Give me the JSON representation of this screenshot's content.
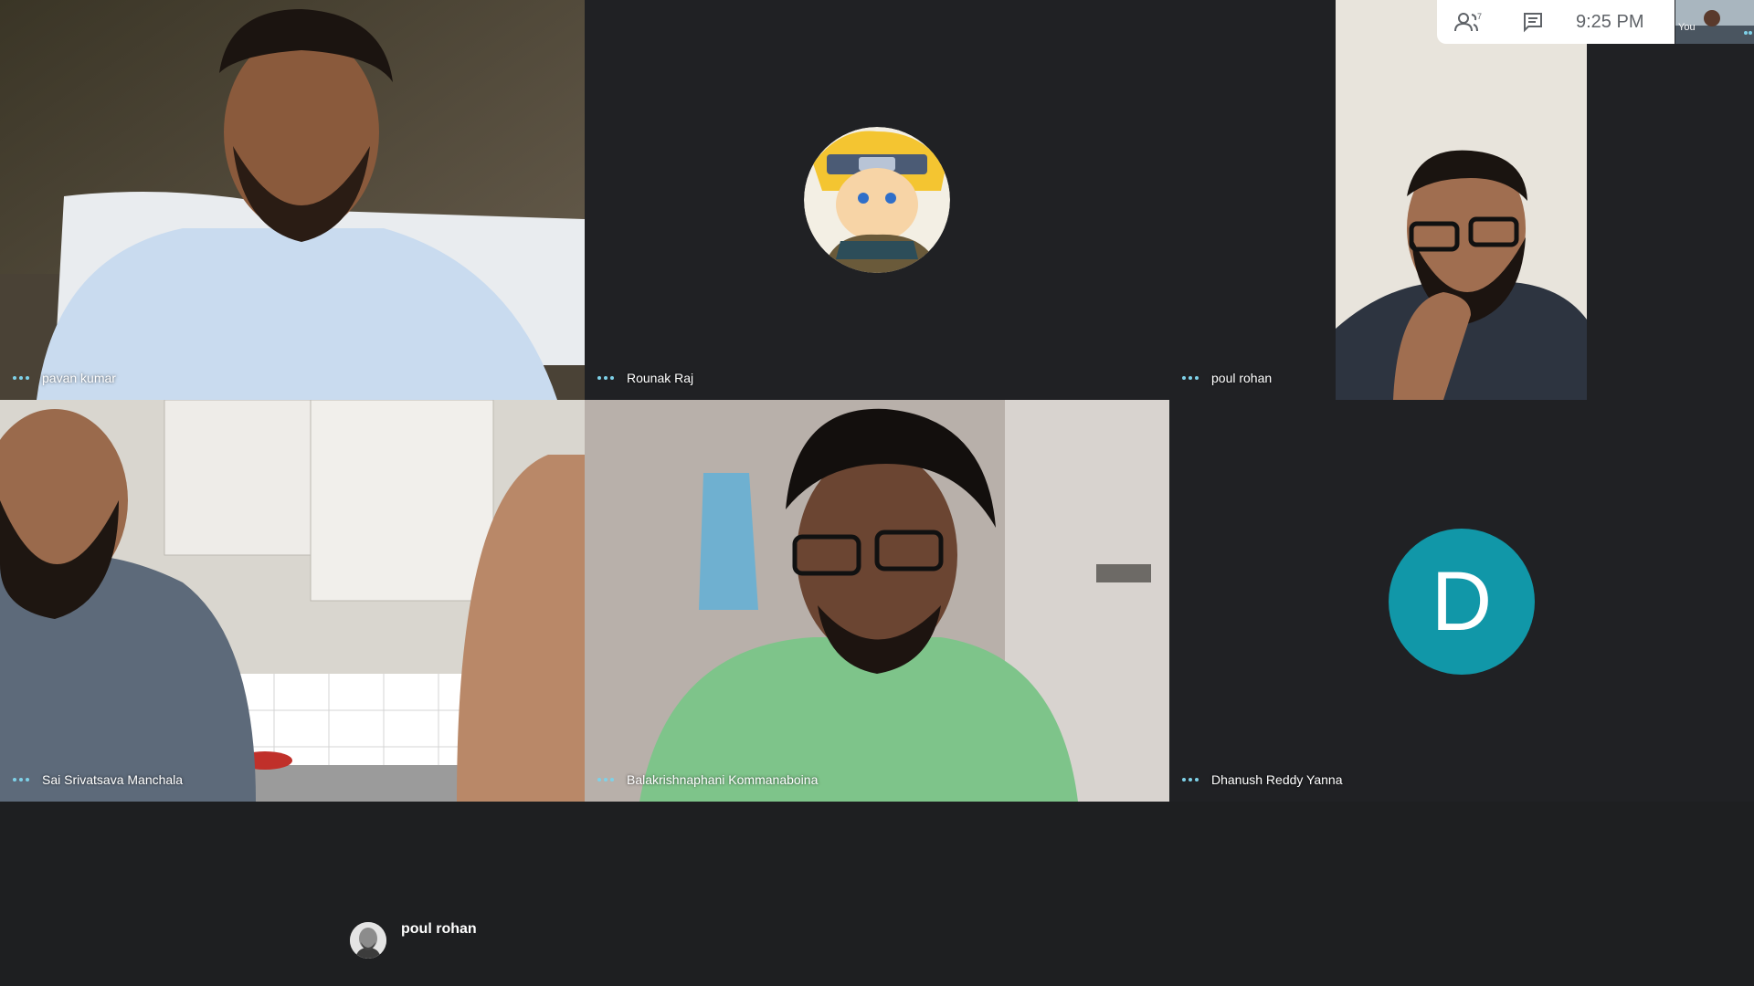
{
  "topbar": {
    "participants_icon": "people-icon",
    "participants_count": "7",
    "chat_icon": "chat-icon",
    "time": "9:25 PM"
  },
  "self_view": {
    "label": "You"
  },
  "tiles": [
    {
      "name": "pavan kumar"
    },
    {
      "name": "Rounak Raj"
    },
    {
      "name": "poul rohan"
    },
    {
      "name": "Sai Srivatsava Manchala"
    },
    {
      "name": "Balakrishnaphani Kommanaboina"
    },
    {
      "name": "Dhanush Reddy Yanna",
      "avatar_letter": "D"
    }
  ],
  "presenter": {
    "name": "poul rohan"
  },
  "colors": {
    "accent": "#1197a8",
    "dots": "#7ed1e8",
    "background": "#202124"
  }
}
